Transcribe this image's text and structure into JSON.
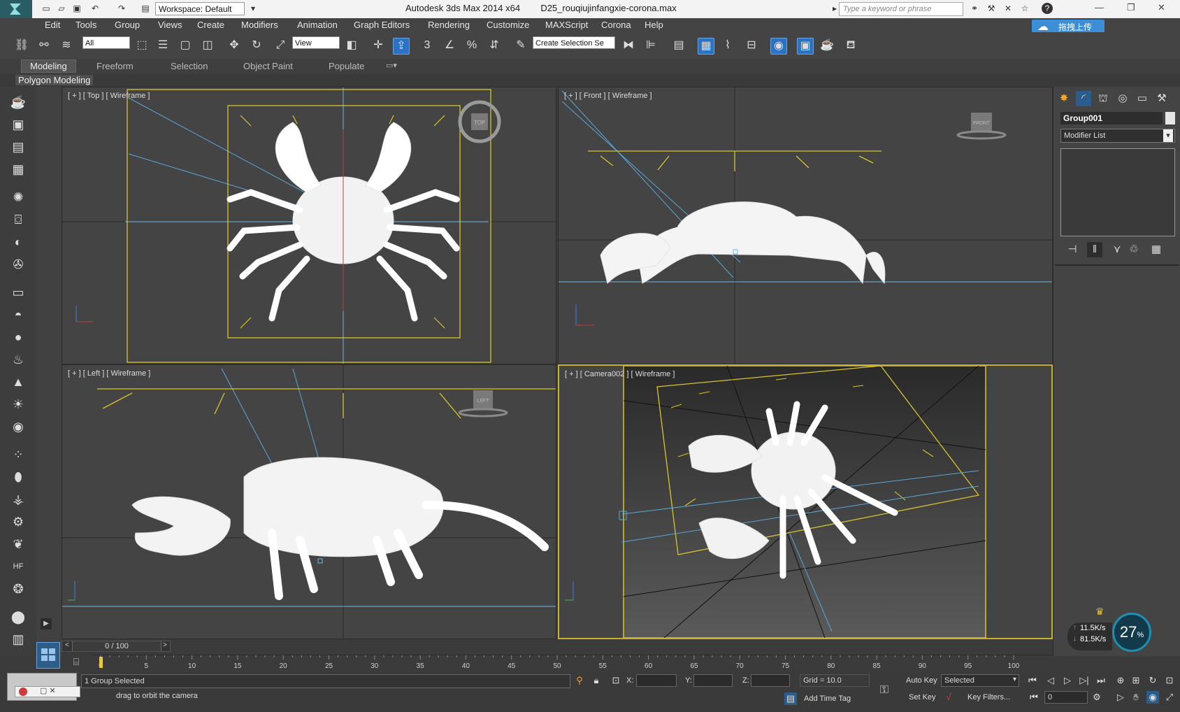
{
  "titlebar": {
    "workspace": "Workspace: Default",
    "app_title": "Autodesk 3ds Max  2014 x64",
    "file_name": "D25_rouqiujinfangxie-corona.max",
    "search_placeholder": "Type a keyword or phrase",
    "help_icon": "?"
  },
  "menus": [
    "Edit",
    "Tools",
    "Group",
    "Views",
    "Create",
    "Modifiers",
    "Animation",
    "Graph Editors",
    "Rendering",
    "Customize",
    "MAXScript",
    "Corona",
    "Help"
  ],
  "cloud_button": "拖拽上传",
  "toolbar": {
    "selection_filter": "All",
    "ref_coord": "View",
    "snap_angle": "3",
    "named_selection": "Create Selection Se"
  },
  "ribbon": {
    "tabs": [
      "Modeling",
      "Freeform",
      "Selection",
      "Object Paint",
      "Populate"
    ],
    "active_tab": "Modeling",
    "panel_label": "Polygon Modeling"
  },
  "viewports": {
    "top": {
      "label": "[ + ] [ Top ] [ Wireframe ]",
      "cube": "TOP"
    },
    "front": {
      "label": "[ + ] [ Front ] [ Wireframe ]",
      "cube": "FRONT"
    },
    "left": {
      "label": "[ + ] [ Left ] [ Wireframe ]",
      "cube": "LEFT"
    },
    "camera": {
      "label": "[ + ] [ Camera002 ] [ Wireframe ]"
    }
  },
  "command_panel": {
    "object_name": "Group001",
    "modifier_list": "Modifier List"
  },
  "timeline": {
    "frame_display": "0 / 100",
    "ticks": [
      "0",
      "5",
      "10",
      "15",
      "20",
      "25",
      "30",
      "35",
      "40",
      "45",
      "50",
      "55",
      "60",
      "65",
      "70",
      "75",
      "80",
      "85",
      "90",
      "95",
      "100"
    ],
    "current_frame": 0
  },
  "status": {
    "selection_count": "1 Group Selected",
    "prompt": "drag to orbit the camera",
    "x_label": "X:",
    "y_label": "Y:",
    "z_label": "Z:",
    "grid": "Grid = 10.0",
    "add_time_tag": "Add Time Tag",
    "auto_key": "Auto Key",
    "set_key": "Set Key",
    "key_mode": "Selected",
    "key_filters": "Key Filters...",
    "frame_field": "0"
  },
  "net_widget": {
    "upload": "11.5K/s",
    "download": "81.5K/s",
    "percent": "27",
    "percent_sign": "%"
  },
  "colors": {
    "accent_blue": "#3c8fd6",
    "active_border": "#c9b031",
    "camera_yellow": "#d8c52a",
    "camera_line": "#4da6d8"
  }
}
